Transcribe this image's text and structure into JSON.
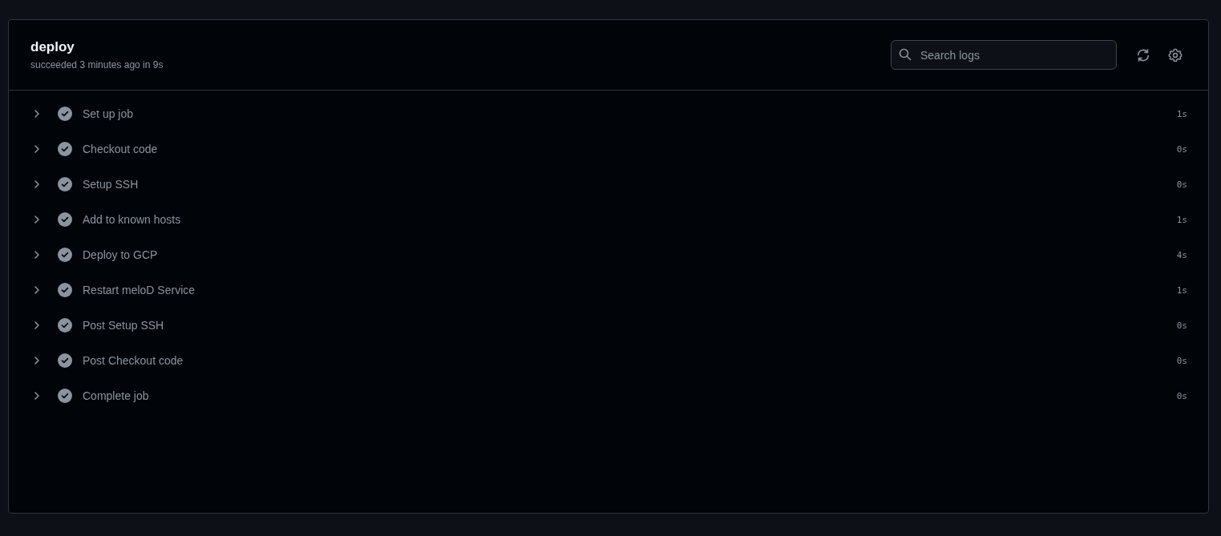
{
  "job": {
    "title": "deploy",
    "summary": "succeeded 3 minutes ago in 9s"
  },
  "search": {
    "placeholder": "Search logs"
  },
  "steps": [
    {
      "name": "Set up job",
      "duration": "1s",
      "kind": "success",
      "expanded": false
    },
    {
      "name": "Checkout code",
      "duration": "0s",
      "kind": "success",
      "expanded": false
    },
    {
      "name": "Setup SSH",
      "duration": "0s",
      "kind": "success",
      "expanded": false
    },
    {
      "name": "Add to known hosts",
      "duration": "1s",
      "kind": "success",
      "expanded": false
    },
    {
      "name": "Deploy to GCP",
      "duration": "4s",
      "kind": "success",
      "expanded": false
    },
    {
      "name": "Restart meloD Service",
      "duration": "1s",
      "kind": "success",
      "expanded": false
    },
    {
      "name": "Post Setup SSH",
      "duration": "0s",
      "kind": "success",
      "expanded": false
    },
    {
      "name": "Post Checkout code",
      "duration": "0s",
      "kind": "success",
      "expanded": false
    },
    {
      "name": "Complete job",
      "duration": "0s",
      "kind": "success",
      "expanded": false
    }
  ]
}
